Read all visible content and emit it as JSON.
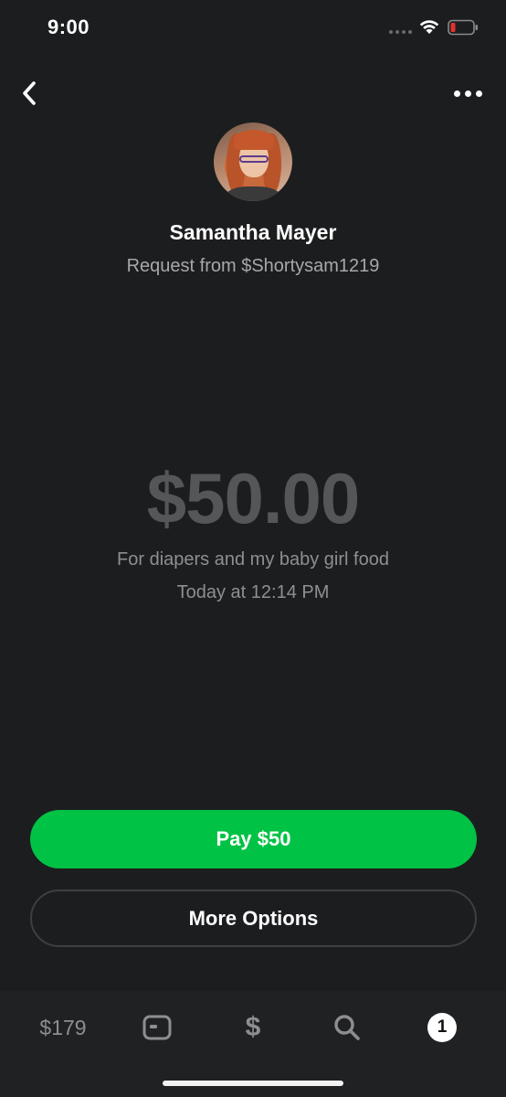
{
  "status_bar": {
    "time": "9:00",
    "wifi_icon": "wifi-icon",
    "battery_icon": "battery-low-icon",
    "battery_color": "#e0342e"
  },
  "nav": {
    "back_icon": "chevron-left-icon",
    "more_icon": "ellipsis-icon"
  },
  "request": {
    "name": "Samantha Mayer",
    "subtitle": "Request from $Shortysam1219",
    "amount": "$50.00",
    "note": "For diapers and my baby girl food",
    "date": "Today at 12:14 PM"
  },
  "actions": {
    "pay_label": "Pay $50",
    "more_options_label": "More Options",
    "pay_color": "#00c244"
  },
  "tab_bar": {
    "balance": "$179",
    "card_icon": "card-icon",
    "pay_symbol": "$",
    "search_icon": "search-icon",
    "activity_badge": "1"
  }
}
